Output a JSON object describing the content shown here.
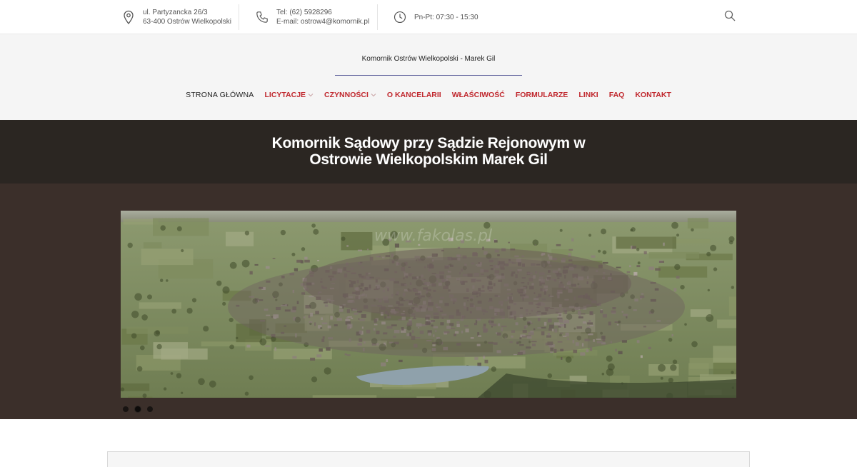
{
  "topbar": {
    "address_line1": "ul. Partyzancka 26/3",
    "address_line2": "63-400 Ostrów Wielkopolski",
    "phone_line": "Tel: (62) 5928296",
    "email_line": "E-mail: ostrow4@komornik.pl",
    "hours": "Pn-Pt: 07:30 - 15:30",
    "icons": {
      "address": "map-pin-icon",
      "phone": "phone-icon",
      "hours": "clock-icon",
      "search": "search-icon"
    }
  },
  "header": {
    "site_title": "Komornik Ostrów Wielkopolski - Marek Gil",
    "nav": [
      {
        "label": "Strona główna",
        "active": true,
        "dropdown": false
      },
      {
        "label": "Licytacje",
        "active": false,
        "dropdown": true
      },
      {
        "label": "Czynności",
        "active": false,
        "dropdown": true
      },
      {
        "label": "O kancelarii",
        "active": false,
        "dropdown": false
      },
      {
        "label": "Właściwość",
        "active": false,
        "dropdown": false
      },
      {
        "label": "Formularze",
        "active": false,
        "dropdown": false
      },
      {
        "label": "Linki",
        "active": false,
        "dropdown": false
      },
      {
        "label": "FAQ",
        "active": false,
        "dropdown": false
      },
      {
        "label": "Kontakt",
        "active": false,
        "dropdown": false
      }
    ]
  },
  "page_title": {
    "line1": "Komornik Sądowy przy Sądzie Rejonowym w",
    "line2": "Ostrowie Wielkopolskim Marek Gil"
  },
  "slider": {
    "watermark": "www.fakolas.pl",
    "slide_count": 3,
    "active_index": 1
  },
  "colors": {
    "accent_red": "#c0272d",
    "title_band": "#2b2622",
    "slider_band": "#3b2f2a",
    "header_bg": "#f5f5f5",
    "title_underline": "#5b5e9a"
  }
}
